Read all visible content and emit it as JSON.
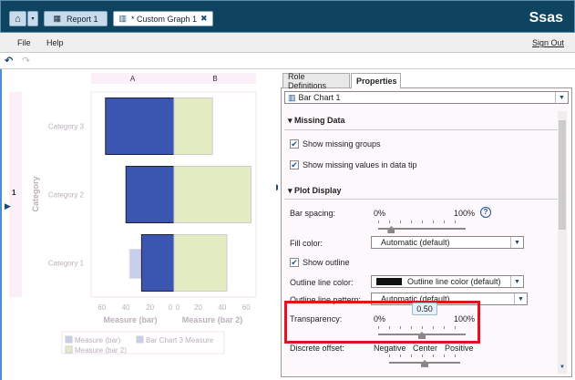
{
  "header": {
    "report_tab": "Report 1",
    "graph_tab": "* Custom Graph 1",
    "logo": "Ssas"
  },
  "menu": {
    "file": "File",
    "help": "Help",
    "sign_out": "Sign Out"
  },
  "chart_panel": {
    "page_number": "1"
  },
  "chart_data": {
    "type": "bar",
    "orientation": "horizontal-butterfly",
    "columns": [
      "A",
      "B"
    ],
    "categories": [
      "Category 3",
      "Category 2",
      "Category 1"
    ],
    "ylabel": "Category",
    "series": [
      {
        "name": "Measure (bar)",
        "values": [
          57,
          40,
          27
        ],
        "color": "#3a56b0"
      },
      {
        "name": "Bar Chart 3 Measure",
        "values": [
          0,
          0,
          37
        ],
        "color": "#c8cfea"
      },
      {
        "name": "Measure (bar 2)",
        "values": [
          32,
          64,
          44
        ],
        "color": "#e4ecc4"
      }
    ],
    "xaxis_left": {
      "label": "Measure (bar)",
      "ticks": [
        "60",
        "40",
        "20",
        "0"
      ],
      "range": [
        0,
        60
      ]
    },
    "xaxis_right": {
      "label": "Measure (bar 2)",
      "ticks": [
        "0",
        "20",
        "40",
        "60"
      ],
      "range": [
        0,
        60
      ]
    },
    "legend": [
      "Measure (bar)",
      "Bar Chart 3 Measure",
      "Measure (bar 2)"
    ]
  },
  "properties": {
    "tabs": [
      "Role Definitions",
      "Properties"
    ],
    "object_select": "Bar Chart 1",
    "missing_data": {
      "title": "Missing Data",
      "show_missing_groups": "Show missing groups",
      "show_missing_tip": "Show missing values in data tip"
    },
    "plot_display": {
      "title": "Plot Display",
      "bar_spacing": {
        "label": "Bar spacing:",
        "min": "0%",
        "max": "100%",
        "value": 0.15
      },
      "fill_color": {
        "label": "Fill color:",
        "value": "Automatic (default)"
      },
      "show_outline": "Show outline",
      "outline_color": {
        "label": "Outline line color:",
        "value": "Outline line color (default)"
      },
      "outline_pattern": {
        "label": "Outline line pattern:",
        "value": "Automatic (default)"
      },
      "transparency": {
        "label": "Transparency:",
        "min": "0%",
        "max": "100%",
        "value": 0.5,
        "tooltip": "0.50"
      },
      "discrete_offset": {
        "label": "Discrete offset:",
        "negative": "Negative",
        "center": "Center",
        "positive": "Positive",
        "value": 0
      }
    }
  }
}
